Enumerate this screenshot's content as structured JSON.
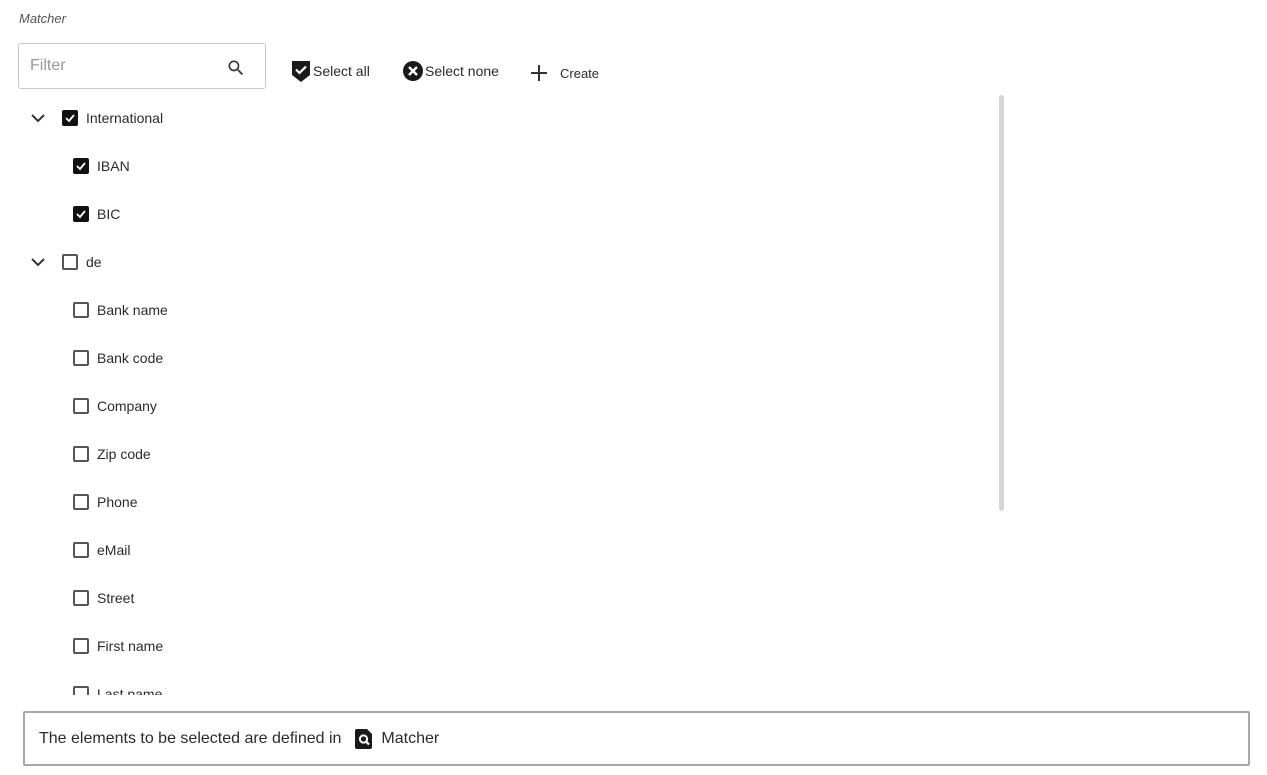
{
  "section": {
    "title": "Matcher"
  },
  "filter": {
    "placeholder": "Filter"
  },
  "toolbar": {
    "select_all_label": "Select all",
    "select_none_label": "Select none",
    "create_label": "Create"
  },
  "tree": {
    "groups": [
      {
        "label": "International",
        "expanded": true,
        "checked": true,
        "items": [
          {
            "label": "IBAN",
            "checked": true
          },
          {
            "label": "BIC",
            "checked": true
          }
        ]
      },
      {
        "label": "de",
        "expanded": true,
        "checked": false,
        "items": [
          {
            "label": "Bank name",
            "checked": false
          },
          {
            "label": "Bank code",
            "checked": false
          },
          {
            "label": "Company",
            "checked": false
          },
          {
            "label": "Zip code",
            "checked": false
          },
          {
            "label": "Phone",
            "checked": false
          },
          {
            "label": "eMail",
            "checked": false
          },
          {
            "label": "Street",
            "checked": false
          },
          {
            "label": "First name",
            "checked": false
          },
          {
            "label": "Last name",
            "checked": false
          }
        ]
      }
    ]
  },
  "footer": {
    "text": "The elements to be selected are defined in",
    "link_label": "Matcher"
  },
  "colors": {
    "checkbox_checked": "#111111",
    "text": "#2b2b2b",
    "border": "#a8a8a8"
  }
}
